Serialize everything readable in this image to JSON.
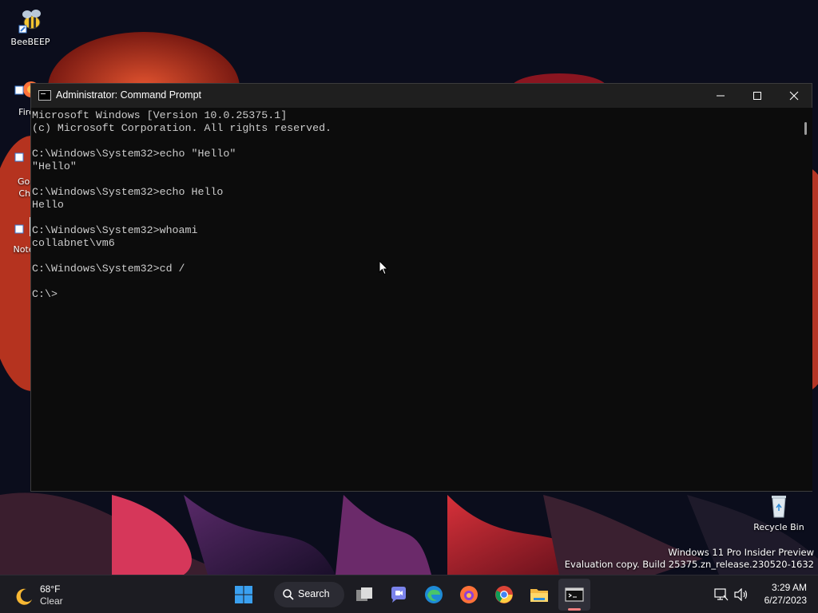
{
  "desktop": {
    "icons": [
      {
        "label": "BeeBEEP",
        "icon": "bee-icon"
      },
      {
        "label": "Fire",
        "icon": "firefox-icon"
      },
      {
        "label": "Goo\nChr",
        "icon": "chrome-icon"
      },
      {
        "label": "Notep",
        "icon": "notepad-icon"
      },
      {
        "label": "Recycle Bin",
        "icon": "recycle-bin-icon"
      }
    ],
    "watermark": {
      "line1": "Windows 11 Pro Insider Preview",
      "line2": "Evaluation copy. Build 25375.zn_release.230520-1632"
    }
  },
  "window": {
    "title": "Administrator: Command Prompt",
    "buttons": {
      "minimize": "minimize-icon",
      "maximize": "maximize-icon",
      "close": "close-icon"
    },
    "lines": [
      "Microsoft Windows [Version 10.0.25375.1]",
      "(c) Microsoft Corporation. All rights reserved.",
      "",
      "C:\\Windows\\System32>echo \"Hello\"",
      "\"Hello\"",
      "",
      "C:\\Windows\\System32>echo Hello",
      "Hello",
      "",
      "C:\\Windows\\System32>whoami",
      "collabnet\\vm6",
      "",
      "C:\\Windows\\System32>cd /",
      "",
      "C:\\>"
    ]
  },
  "taskbar": {
    "weather": {
      "temp": "68°F",
      "condition": "Clear",
      "icon": "moon-icon"
    },
    "search_label": "Search",
    "apps": [
      "windows-start-icon",
      "search-icon",
      "task-view-icon",
      "teams-chat-icon",
      "edge-icon",
      "firefox-icon",
      "chrome-icon",
      "file-explorer-icon",
      "terminal-icon"
    ],
    "tray": {
      "network": "network-icon",
      "volume": "volume-icon"
    },
    "clock": {
      "time": "3:29 AM",
      "date": "6/27/2023"
    }
  },
  "colors": {
    "console_bg": "#0c0c0c",
    "console_text": "#cccccc",
    "taskbar_bg": "#1c1c22",
    "accent": "#0078d4"
  }
}
